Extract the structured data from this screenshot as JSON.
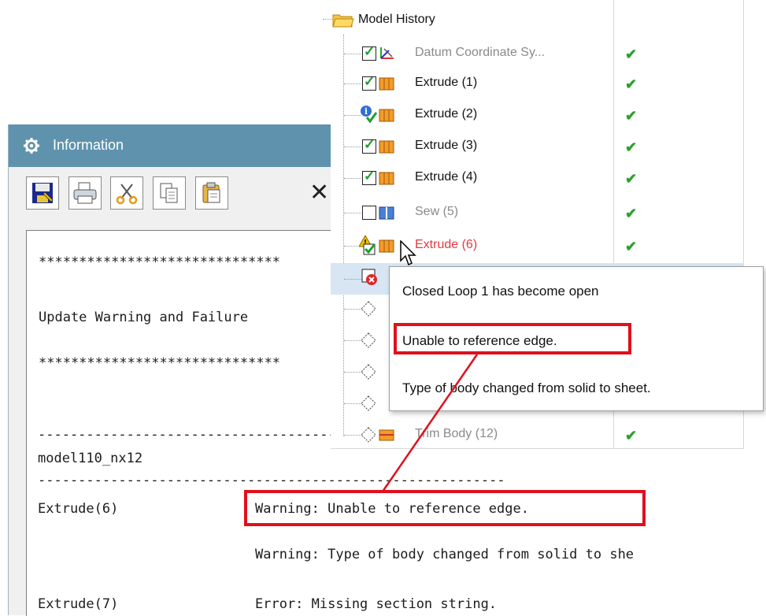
{
  "info_window": {
    "title": "Information",
    "title_icon": "gear-icon",
    "toolbar": [
      {
        "name": "save-icon"
      },
      {
        "name": "print-icon"
      },
      {
        "name": "cut-icon"
      },
      {
        "name": "copy-icon"
      },
      {
        "name": "paste-icon"
      },
      {
        "name": "close-icon",
        "glyph": "✕"
      }
    ],
    "lines": {
      "stars1": "******************************",
      "heading": "Update Warning and Failure",
      "stars2": "******************************",
      "dashes1": "------------------------------------------------------------",
      "model": "model110_nx12",
      "dashes2": "----------------------------------------------------------",
      "item1_name": "Extrude(6)",
      "item1_msg": "Warning: Unable to reference edge.",
      "item1_msg2": "Warning: Type of body changed from solid to she",
      "item2_name": "Extrude(7)",
      "item2_msg": "Error: Missing section string."
    }
  },
  "model_history": {
    "root_label": "Model History",
    "root_icon": "folder-icon",
    "items": [
      {
        "label": "Datum Coordinate Sy...",
        "state": "checked",
        "style": "gray",
        "icon": "datum-csys-icon",
        "status": "✔"
      },
      {
        "label": "Extrude (1)",
        "state": "checked",
        "style": "normal",
        "icon": "extrude-icon",
        "status": "✔"
      },
      {
        "label": "Extrude (2)",
        "state": "info",
        "style": "normal",
        "icon": "extrude-icon",
        "status": "✔"
      },
      {
        "label": "Extrude (3)",
        "state": "checked",
        "style": "normal",
        "icon": "extrude-icon",
        "status": "✔"
      },
      {
        "label": "Extrude (4)",
        "state": "checked",
        "style": "normal",
        "icon": "extrude-icon",
        "status": "✔"
      },
      {
        "label": "Sew (5)",
        "state": "unchecked",
        "style": "gray",
        "icon": "sew-icon",
        "status": "✔"
      },
      {
        "label": "Extrude (6)",
        "state": "warning",
        "style": "red",
        "icon": "extrude-icon",
        "status": "✔"
      },
      {
        "label": "",
        "state": "error",
        "style": "normal",
        "icon": "extrude-icon",
        "status": ""
      },
      {
        "label": "",
        "state": "empty",
        "style": "gray",
        "icon": "diamond-icon",
        "status": ""
      },
      {
        "label": "",
        "state": "empty",
        "style": "gray",
        "icon": "diamond-icon",
        "status": ""
      },
      {
        "label": "",
        "state": "empty",
        "style": "gray",
        "icon": "diamond-icon",
        "status": ""
      },
      {
        "label": "",
        "state": "empty",
        "style": "gray",
        "icon": "diamond-icon",
        "status": "✔"
      },
      {
        "label": "Trim Body (12)",
        "state": "empty",
        "style": "gray",
        "icon": "trim-body-icon",
        "status": "✔"
      }
    ]
  },
  "tooltip": {
    "lines": [
      "Closed Loop 1 has become open",
      "Unable to reference edge.",
      "Type of body changed from solid to sheet."
    ]
  },
  "colors": {
    "titlebar": "#5f93ad",
    "highlight_box": "#e0101c",
    "status_ok": "#2ca02c",
    "warning_text": "#e0393e"
  }
}
